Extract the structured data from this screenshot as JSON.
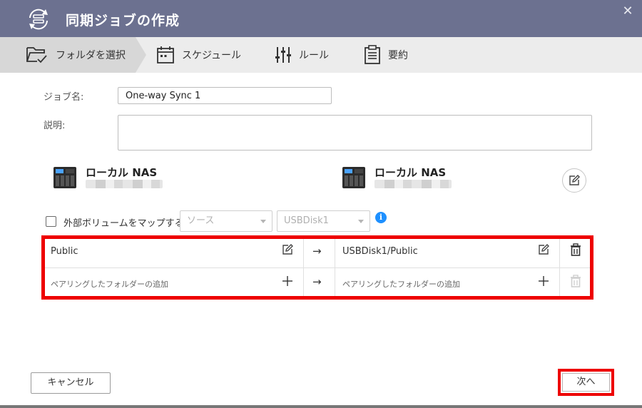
{
  "window": {
    "title": "同期ジョブの作成",
    "close_symbol": "✕"
  },
  "steps": [
    {
      "label": "フォルダを選択",
      "icon": "folder-check-icon",
      "active": true
    },
    {
      "label": "スケジュール",
      "icon": "calendar-icon",
      "active": false
    },
    {
      "label": "ルール",
      "icon": "sliders-icon",
      "active": false
    },
    {
      "label": "要約",
      "icon": "clipboard-icon",
      "active": false
    }
  ],
  "form": {
    "job_name_label": "ジョブ名:",
    "job_name_value": "One-way Sync 1",
    "description_label": "説明:",
    "description_value": ""
  },
  "source_nas": {
    "title": "ローカル NAS"
  },
  "dest_nas": {
    "title": "ローカル NAS"
  },
  "map_volume": {
    "label": "外部ボリュームをマップする",
    "checked": false,
    "source_select": "ソース",
    "dest_select": "USBDisk1",
    "info_symbol": "i"
  },
  "pairs": [
    {
      "source": "Public",
      "arrow": "→",
      "destination": "USBDisk1/Public"
    },
    {
      "source": "ペアリングしたフォルダーの追加",
      "arrow": "→",
      "destination": "ペアリングしたフォルダーの追加"
    }
  ],
  "buttons": {
    "cancel": "キャンセル",
    "next": "次へ"
  },
  "colors": {
    "titlebar": "#6c7190",
    "highlight": "#ee0000",
    "info": "#1e90ff"
  }
}
